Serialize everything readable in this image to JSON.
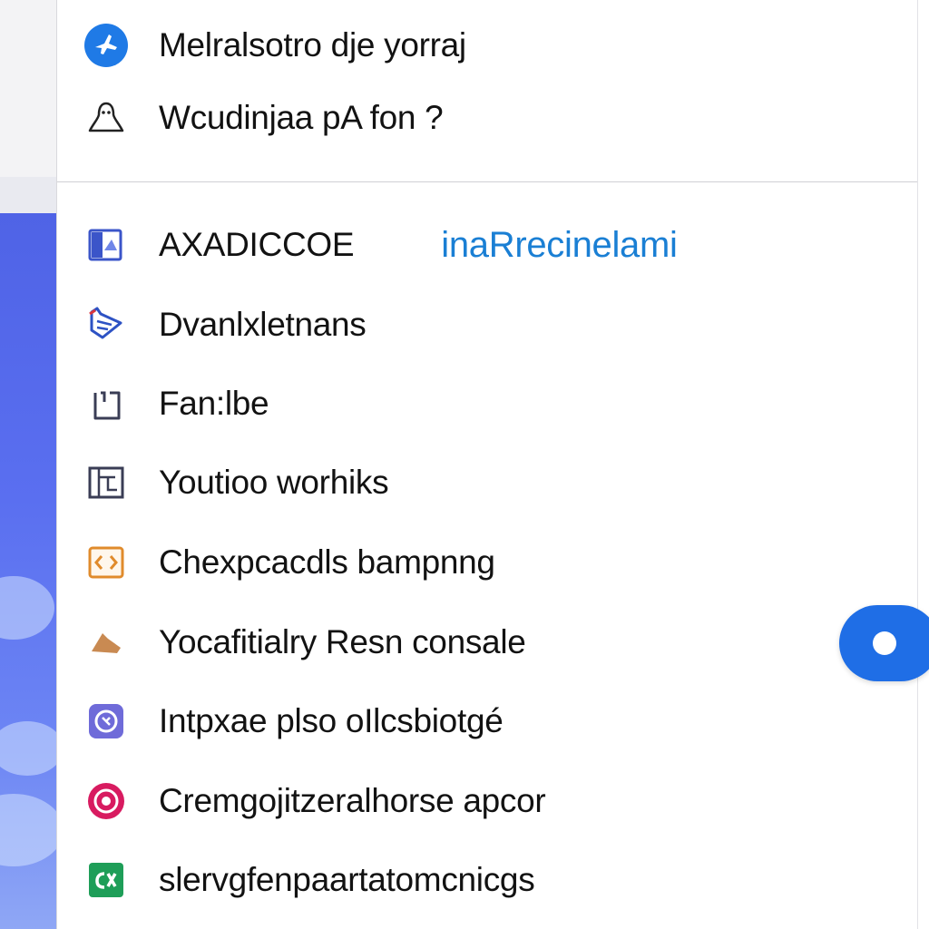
{
  "menu": {
    "top_items": [
      {
        "label": "Melralsotro dje yorraj",
        "icon": "blue-plane-icon",
        "color": "#1f7ae6"
      },
      {
        "label": "Wcudinjaa pA fon ?",
        "icon": "person-outline-icon"
      }
    ],
    "items": [
      {
        "label": "AXADICCOE",
        "link": "inaRrecinelami",
        "icon": "app-window-icon",
        "color": "#3b55c9"
      },
      {
        "label": "Dvanlxletnans",
        "icon": "message-card-icon",
        "color": "#2d52c4"
      },
      {
        "label": "Fan:lbe",
        "icon": "phone-frame-icon"
      },
      {
        "label": "Youtioo worhiks",
        "icon": "layout-grid-icon"
      },
      {
        "label": "Chexpcacdls bampnng",
        "icon": "code-box-icon",
        "color": "#e08b2c"
      },
      {
        "label": "Yocafitialry Resn consale",
        "icon": "brown-triangle-icon",
        "color": "#c98a52"
      },
      {
        "label": "Intpxae plso oIlcsbiotgé",
        "icon": "purple-badge-icon",
        "color": "#6f6bd9"
      },
      {
        "label": "Cremgojitzeralhorse apcor",
        "icon": "pink-target-icon",
        "color": "#d81b60"
      },
      {
        "label": "slervgfenpaartatomcnicgs",
        "icon": "green-code-icon",
        "color": "#1e9e58"
      }
    ]
  },
  "toggle": {
    "state": "on",
    "color": "#1f6ee6"
  }
}
